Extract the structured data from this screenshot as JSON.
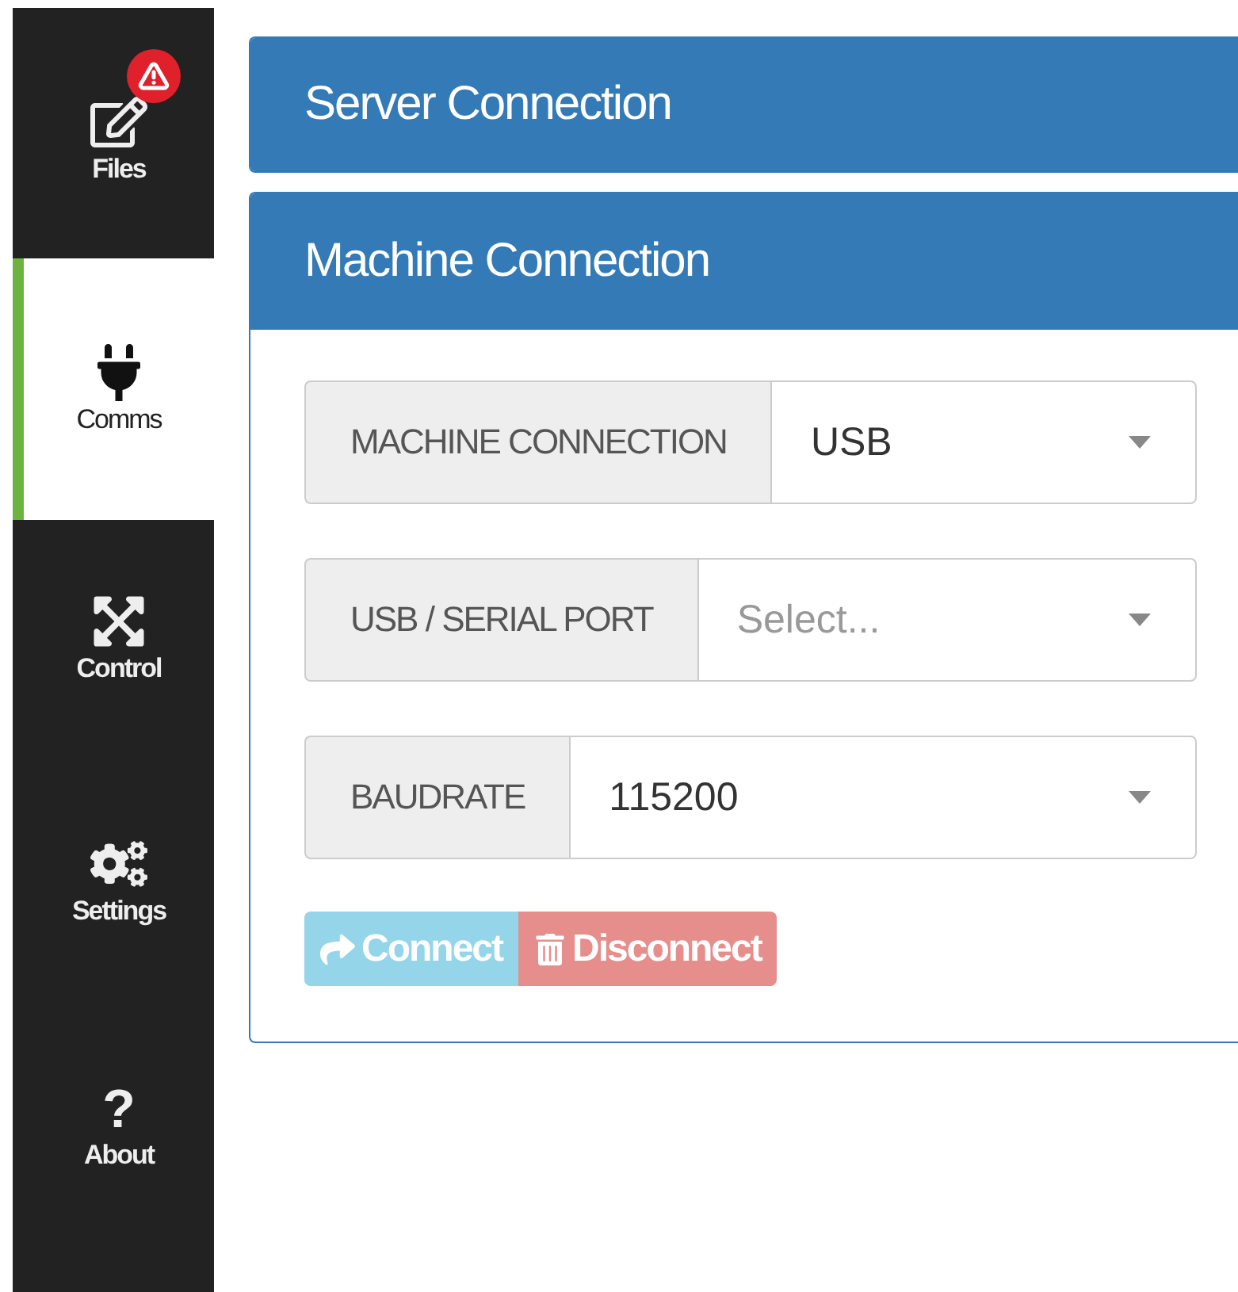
{
  "sidebar": {
    "items": [
      {
        "kind": "files",
        "label": "Files",
        "selected": false,
        "alert": true
      },
      {
        "kind": "comms",
        "label": "Comms",
        "selected": true,
        "alert": false
      },
      {
        "kind": "control",
        "label": "Control",
        "selected": false,
        "alert": false
      },
      {
        "kind": "settings",
        "label": "Settings",
        "selected": false,
        "alert": false
      },
      {
        "kind": "about",
        "label": "About",
        "selected": false,
        "alert": false,
        "glyph": "?"
      }
    ]
  },
  "panels": [
    {
      "title": "Server Connection",
      "expanded": false
    },
    {
      "title": "Machine Connection",
      "expanded": true,
      "fields": [
        {
          "label": "MACHINE CONNECTION",
          "value": "USB"
        },
        {
          "label": "USB / SERIAL PORT",
          "placeholder": "Select..."
        },
        {
          "label": "BAUDRATE",
          "value": "115200"
        }
      ],
      "buttons": [
        {
          "kind": "connect",
          "label": "Connect",
          "disabled": true
        },
        {
          "kind": "disconnect",
          "label": "Disconnect",
          "disabled": true
        }
      ]
    }
  ]
}
